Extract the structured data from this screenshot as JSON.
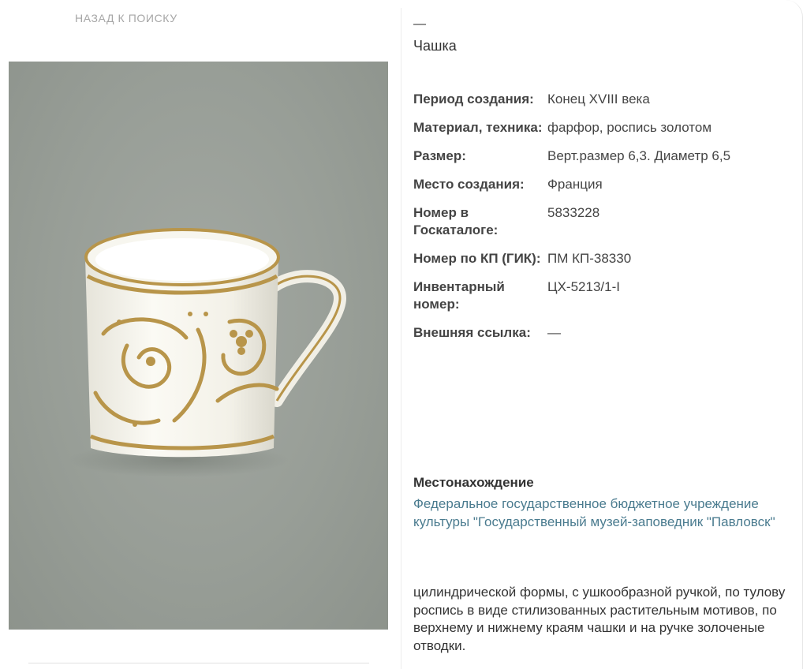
{
  "nav": {
    "back_label": "НАЗАД К ПОИСКУ"
  },
  "item": {
    "dash": "—",
    "title": "Чашка"
  },
  "properties": [
    {
      "label": "Период создания:",
      "value": "Конец XVIII века"
    },
    {
      "label": "Материал, техника:",
      "value": "фарфор, роспись золотом"
    },
    {
      "label": "Размер:",
      "value": "Верт.размер 6,3. Диаметр 6,5"
    },
    {
      "label": "Место создания:",
      "value": "Франция"
    },
    {
      "label": "Номер в Госкаталоге:",
      "value": "5833228"
    },
    {
      "label": "Номер по КП (ГИК):",
      "value": "ПМ КП-38330"
    },
    {
      "label": "Инвентарный номер:",
      "value": "ЦХ-5213/1-I"
    },
    {
      "label": "Внешняя ссылка:",
      "value": "—"
    }
  ],
  "location": {
    "heading": "Местонахождение",
    "link_text": "Федеральное государственное бюджетное учреждение культуры \"Государственный музей-заповедник \"Павловск\""
  },
  "description": "цилиндрической формы, с ушкообразной ручкой, по тулову роспись в виде стилизованных растительным мотивов, по верхнему и нижнему краям чашки и на ручке золоченые отводки.",
  "colors": {
    "link": "#4a7b8f",
    "photo_background": "#989e97",
    "gold": "#b8954a"
  }
}
